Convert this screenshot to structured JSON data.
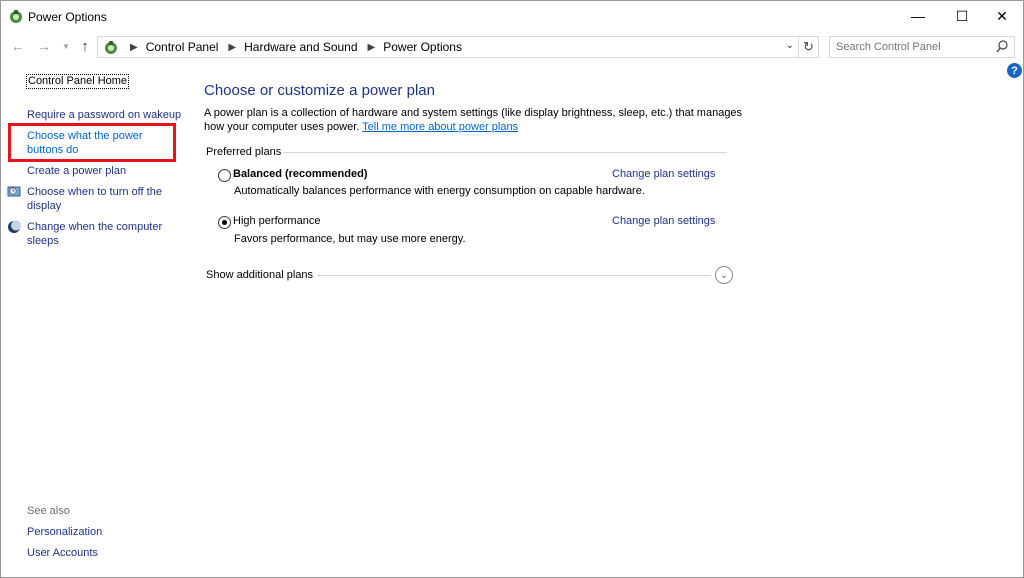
{
  "window": {
    "title": "Power Options",
    "minimize_label": "—",
    "maximize_label": "☐",
    "close_label": "✕"
  },
  "address": {
    "breadcrumbs": [
      "Control Panel",
      "Hardware and Sound",
      "Power Options"
    ],
    "search_placeholder": "Search Control Panel"
  },
  "sidebar": {
    "home": "Control Panel Home",
    "tasks": [
      {
        "label_1": "Require a password on wakeup"
      },
      {
        "label_1": "Choose what the power",
        "label_2": "buttons do"
      },
      {
        "label_1": "Create a power plan"
      },
      {
        "label_1": "Choose when to turn off the",
        "label_2": "display"
      },
      {
        "label_1": "Change when the computer",
        "label_2": "sleeps"
      }
    ],
    "see_also_heading": "See also",
    "see_also": [
      "Personalization",
      "User Accounts"
    ]
  },
  "main": {
    "title": "Choose or customize a power plan",
    "description_line1": "A power plan is a collection of hardware and system settings (like display brightness, sleep, etc.) that manages",
    "description_line2": "how your computer uses power.",
    "description_link": "Tell me more about power plans",
    "group_title": "Preferred plans",
    "plans": [
      {
        "name": "Balanced (recommended)",
        "description": "Automatically balances performance with energy consumption on capable hardware.",
        "selected": false,
        "link": "Change plan settings"
      },
      {
        "name": "High performance",
        "description": "Favors performance, but may use more energy.",
        "selected": true,
        "link": "Change plan settings"
      }
    ],
    "show_additional": "Show additional plans"
  },
  "colors": {
    "link": "#1e3287",
    "hyperlink": "#0066cc",
    "highlight_box": "#e8121b",
    "help": "#1a66c7"
  },
  "icons": [
    "power-options-icon",
    "back-arrow-icon",
    "forward-arrow-icon",
    "up-arrow-icon",
    "refresh-icon",
    "search-icon",
    "help-icon",
    "monitor-clock-icon",
    "moon-sleep-icon",
    "expand-chevron-icon"
  ]
}
